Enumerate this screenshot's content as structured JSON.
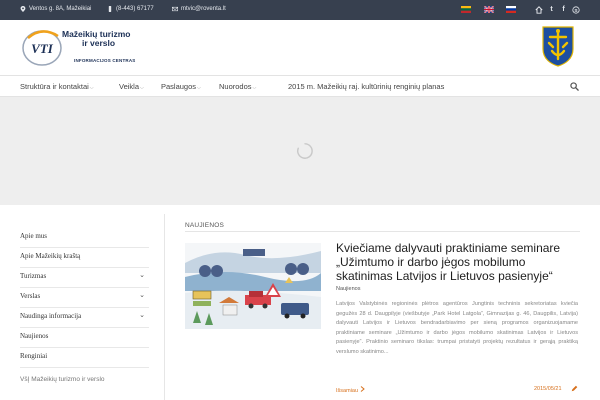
{
  "topbar": {
    "address": "Ventos g. 8A, Mažeikiai",
    "phone": "(8-443) 67177",
    "email": "mtvic@roventa.lt",
    "languages": [
      "lt",
      "en",
      "ru"
    ],
    "social": [
      {
        "name": "home-icon",
        "glyph": "⌂"
      },
      {
        "name": "twitter-icon",
        "glyph": "t"
      },
      {
        "name": "facebook-icon",
        "glyph": "f"
      },
      {
        "name": "skype-icon",
        "glyph": "S"
      }
    ]
  },
  "header": {
    "logo_line1": "Mažeikių turizmo",
    "logo_line2": "ir verslo",
    "logo_sub": "INFORMACIJOS CENTRAS",
    "logo_mark": "VTI"
  },
  "nav": {
    "items": [
      {
        "label": "Struktūra ir kontaktai",
        "dropdown": true
      },
      {
        "label": "Veikla",
        "dropdown": true
      },
      {
        "label": "Paslaugos",
        "dropdown": true
      },
      {
        "label": "Nuorodos",
        "dropdown": true
      },
      {
        "label": "2015 m. Mažeikių raj. kultūrinių renginių planas",
        "dropdown": false
      }
    ]
  },
  "sidebar": {
    "items": [
      {
        "label": "Apie mus",
        "dropdown": false
      },
      {
        "label": "Apie Mažeikių kraštą",
        "dropdown": false
      },
      {
        "label": "Turizmas",
        "dropdown": true
      },
      {
        "label": "Verslas",
        "dropdown": true
      },
      {
        "label": "Naudinga informacija",
        "dropdown": true
      },
      {
        "label": "Naujienos",
        "dropdown": false
      },
      {
        "label": "Renginiai",
        "dropdown": false
      }
    ],
    "footer": "VšĮ Mažeikių turizmo ir verslo"
  },
  "content": {
    "section_title": "NAUJIENOS",
    "post": {
      "title": "Kviečiame dalyvauti praktiniame seminare „Užimtumo ir darbo jėgos mobilumo skatinimas Latvijos ir Lietuvos pasienyje“",
      "category": "Naujienos",
      "excerpt": "Latvijos Valstybinės regioninės plėtros agentūros Jungtinis techninis sekretoriatas kviečia gegužės 28 d. Daugpilyje (viešbutyje „Park Hotel Latgola“, Gimnazijas g. 46, Daugpilis, Latvija) dalyvauti Latvijos ir Lietuvos bendradarbiavimo per sieną programos organizuojamame praktiniame seminare „Užimtumo ir darbo jėgos mobilumo skatinimas Latvijos ir Lietuvos pasienyje“. Praktinio seminaro tikslas: trumpai pristatyti projektų rezultatus ir gerąją praktiką verslumo skatinimo...",
      "more_label": "Išsamiau",
      "date": "2015/05/21"
    }
  },
  "colors": {
    "topbar": "#37404f",
    "accent": "#d7701c",
    "brand": "#1b2f55"
  }
}
